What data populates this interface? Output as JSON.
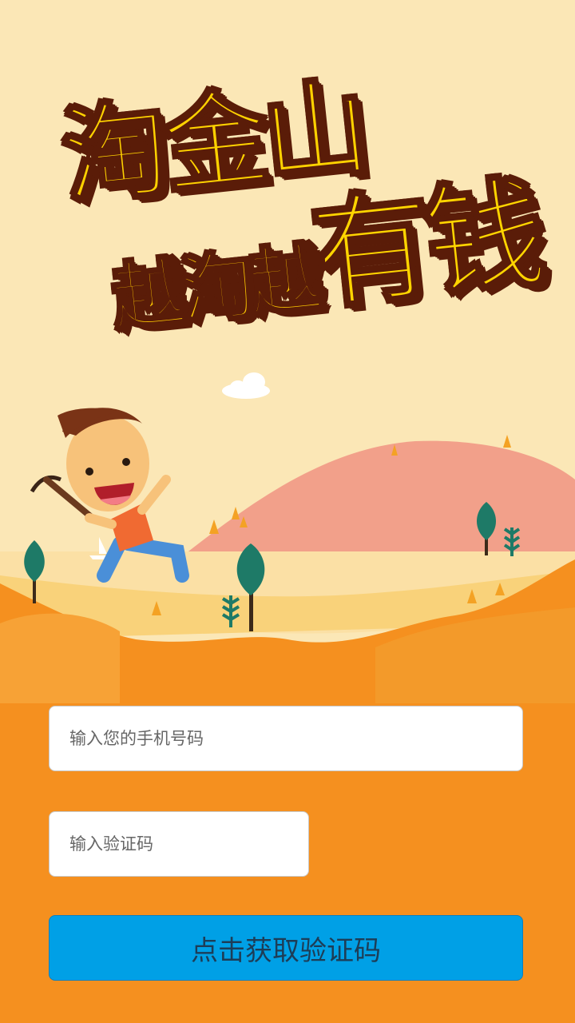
{
  "banner": {
    "line1": "淘金山",
    "line2": "越淘越",
    "line3": "有钱"
  },
  "form": {
    "phone_placeholder": "输入您的手机号码",
    "code_placeholder": "输入验证码",
    "get_code_button": "点击获取验证码"
  },
  "colors": {
    "sky": "#fbe7b6",
    "ground": "#f5901f",
    "hill": "#f2a08a",
    "button": "#00a0e6",
    "title_yellow": "#ffd200",
    "title_outline": "#5a1c08"
  }
}
